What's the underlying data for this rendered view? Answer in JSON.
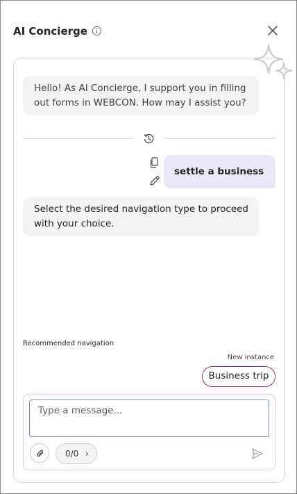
{
  "header": {
    "title": "AI Concierge",
    "info_icon": "info-icon",
    "close_icon": "close-icon"
  },
  "conversation": {
    "greeting": "Hello! As AI Concierge, I support you in filling out forms in WEBCON. How may I assist you?",
    "history_icon": "history-icon",
    "user_message": "settle a business trip",
    "user_actions": [
      "copy-icon",
      "edit-icon"
    ],
    "bot_reply": "Select the desired navigation type to proceed with your choice."
  },
  "recommendation": {
    "label": "Recommended navigation",
    "option_caption": "New instance",
    "option_label": "Business trip",
    "accent": "#b0286d"
  },
  "composer": {
    "placeholder": "Type a message...",
    "value": "",
    "counter": "0/0",
    "counter_chevron": "›",
    "attach_icon": "paperclip-icon",
    "send_icon": "send-icon"
  },
  "colors": {
    "user_bubble": "#e8e8f7",
    "bot_bubble": "#f3f3f3",
    "input_border": "#7a8fd0"
  }
}
